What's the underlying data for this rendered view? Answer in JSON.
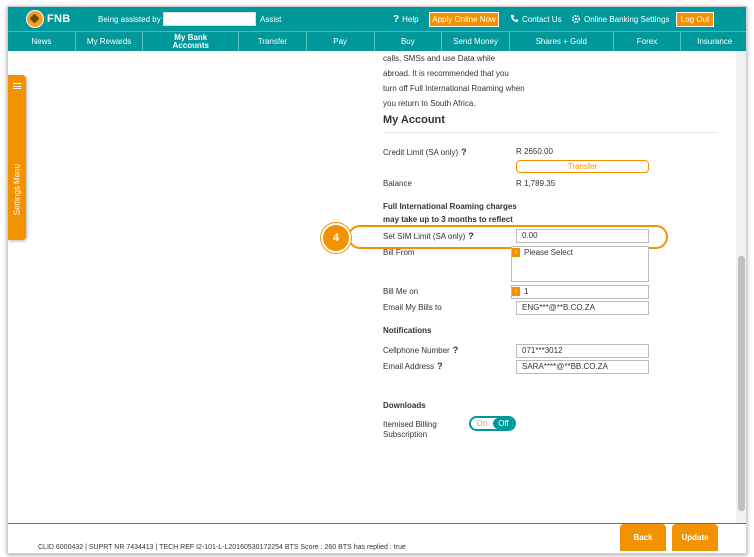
{
  "header": {
    "logo_text": "FNB",
    "assisted_label": "Being assisted by",
    "assisted_value": "",
    "assist_label": "Assist",
    "help_icon": "?",
    "help_label": "Help",
    "apply_label": "Apply Online Now",
    "contact_label": "Contact Us",
    "settings_label": "Online Banking Settings",
    "logout_label": "Log Out"
  },
  "nav": {
    "items": [
      {
        "label": "News"
      },
      {
        "label": "My Rewards"
      },
      {
        "label": "My Bank Accounts"
      },
      {
        "label": "Transfer"
      },
      {
        "label": "Pay"
      },
      {
        "label": "Buy"
      },
      {
        "label": "Send Money"
      },
      {
        "label": "Shares + Gold"
      },
      {
        "label": "Forex"
      },
      {
        "label": "Insurance"
      }
    ],
    "active_index": 2
  },
  "side_menu": {
    "label": "Settings Menu"
  },
  "content": {
    "intro_lines": [
      "calls, SMSs and use Data while",
      "abroad. It is recommended that you",
      "turn off Full International Roaming when",
      "you return to South Africa."
    ],
    "section_title": "My Account",
    "credit_limit_label": "Credit Limit (SA only)",
    "credit_limit_value": "R 2650.00",
    "transfer_label": "Transfer",
    "balance_label": "Balance",
    "balance_value": "R 1,789.35",
    "roaming_note_line1": "Full International Roaming charges",
    "roaming_note_line2": "may take up to 3 months to reflect",
    "sim_limit_label": "Set SIM Limit (SA only)",
    "sim_limit_value": "0.00",
    "step_number": "4",
    "bill_from_label": "Bill From",
    "bill_from_value": "Please Select",
    "bill_me_on_label": "Bill Me on",
    "bill_me_on_value": "1",
    "email_bills_label": "Email My Bills to",
    "email_bills_value": "ENG***@**B.CO.ZA",
    "notifications_title": "Notifications",
    "cellphone_label": "Cellphone Number",
    "cellphone_value": "071***3012",
    "email_address_label": "Email Address",
    "email_address_value": "SARA****@**BB.CO.ZA",
    "downloads_title": "Downloads",
    "itemised_label_line1": "Itemised Billing",
    "itemised_label_line2": "Subscription",
    "toggle_on_label": "On",
    "toggle_off_label": "Off",
    "question_mark": "?"
  },
  "footer": {
    "status_text": "CLID 6000432 | SUPRT NR 7434413 | TECH REF I2-101-L-L20160530172254 BTS Score : 260 BTS has replied : true",
    "back_label": "Back",
    "update_label": "Update"
  },
  "colors": {
    "brand_teal": "#00989a",
    "accent_orange": "#f39200"
  }
}
